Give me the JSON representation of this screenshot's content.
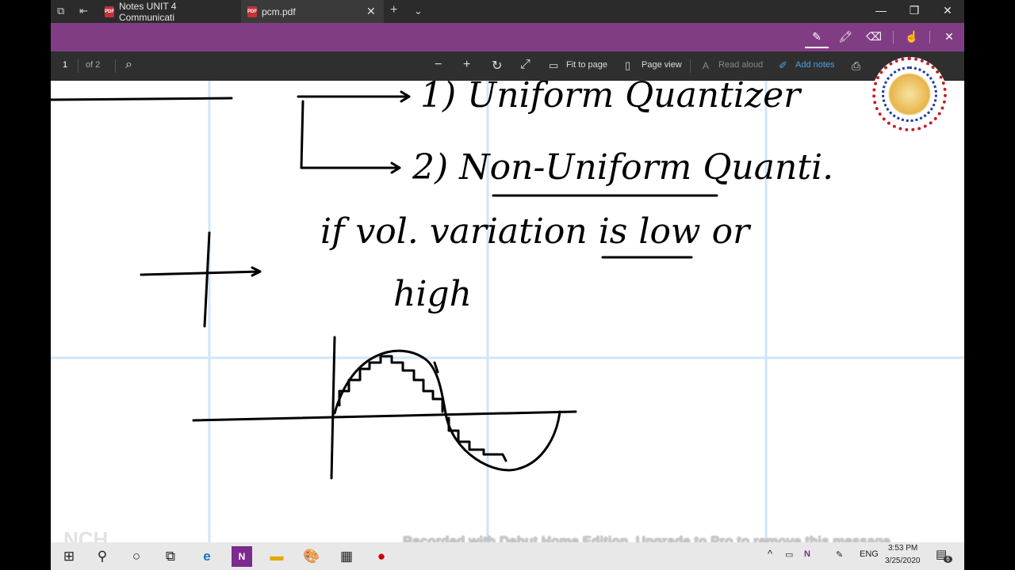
{
  "titlebar": {
    "tabs": [
      {
        "label": "Notes UNIT 4 Communicati",
        "active": false
      },
      {
        "label": "pcm.pdf",
        "active": true
      }
    ],
    "new_tab": "+",
    "tab_menu": "⌄",
    "close_tab": "✕",
    "window": {
      "minimize": "—",
      "maximize": "❐",
      "close": "✕"
    }
  },
  "toolbar": {
    "page_number": "1",
    "page_total": "of 2",
    "fit_to_page": "Fit to page",
    "page_view": "Page view",
    "read_aloud": "Read aloud",
    "add_notes": "Add notes"
  },
  "content": {
    "line1": "1) Uniform Quantizer",
    "line2": "2) Non-Uniform Quanti.",
    "line3": "if vol. variation is low or",
    "line4": "high"
  },
  "watermark": "Recorded with Debut Home Edition. Upgrade to Pro to remove this message",
  "nch_logo": "NCH",
  "taskbar": {
    "language": "ENG",
    "time": "3:53 PM",
    "date": "3/25/2020",
    "notifications": "6"
  },
  "colors": {
    "ribbon": "#813d83",
    "titlebar": "#2b2b2b",
    "toolbar": "#2f2f2f",
    "grid": "#cfe6f7",
    "add_notes": "#4aa3e8"
  }
}
